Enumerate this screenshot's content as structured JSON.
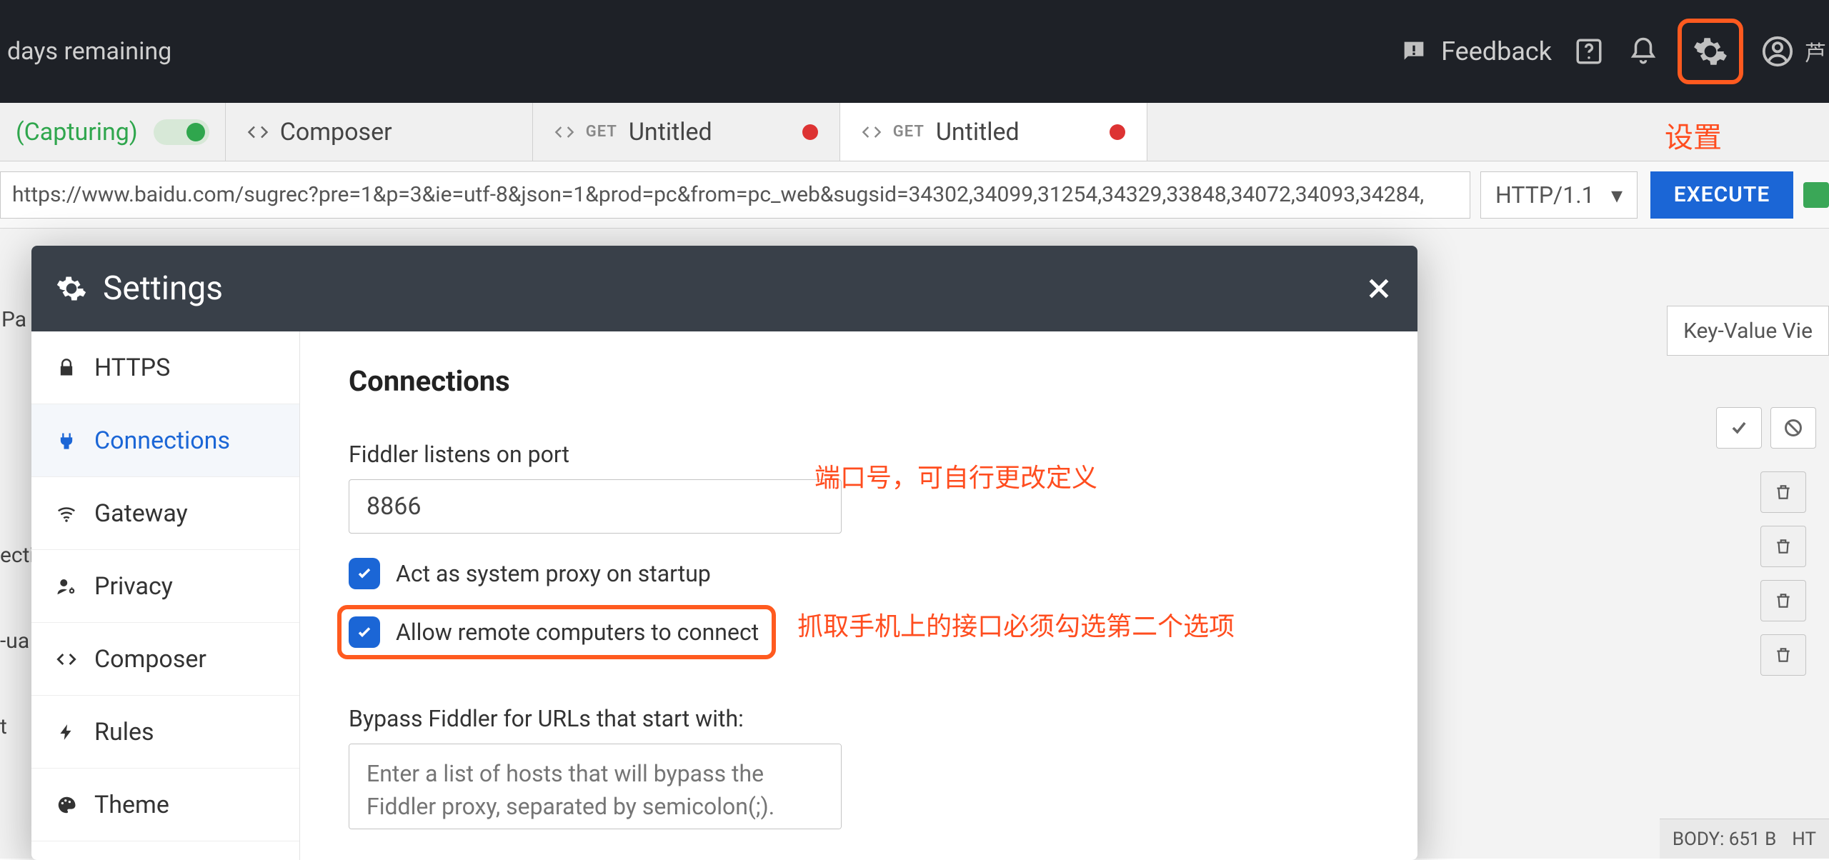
{
  "topbar": {
    "trial_text": "days remaining",
    "feedback_label": "Feedback"
  },
  "annotations": {
    "settings_gear": "设置",
    "port_note": "端口号，可自行更改定义",
    "remote_note": "抓取手机上的接口必须勾选第二个选项"
  },
  "tabs_row": {
    "capturing_label": "(Capturing)",
    "tabs": [
      {
        "method": "",
        "label": "Composer",
        "modified": false
      },
      {
        "method": "GET",
        "label": "Untitled",
        "modified": true
      },
      {
        "method": "GET",
        "label": "Untitled",
        "modified": true
      }
    ]
  },
  "url_row": {
    "url": "https://www.baidu.com/sugrec?pre=1&p=3&ie=utf-8&json=1&prod=pc&from=pc_web&sugsid=34302,34099,31254,34329,33848,34072,34093,34284,",
    "http_version": "HTTP/1.1",
    "execute_label": "EXECUTE"
  },
  "background": {
    "pa_label": "Pa",
    "kv_label": "Key-Value Vie",
    "truncated_rows": [
      "ecti",
      "-ua",
      "t"
    ],
    "status_body": "BODY: 651 B",
    "status_ht": "HT"
  },
  "modal": {
    "title": "Settings",
    "sidebar": [
      {
        "key": "https",
        "label": "HTTPS",
        "icon": "lock"
      },
      {
        "key": "connections",
        "label": "Connections",
        "icon": "plug"
      },
      {
        "key": "gateway",
        "label": "Gateway",
        "icon": "wifi"
      },
      {
        "key": "privacy",
        "label": "Privacy",
        "icon": "user-cog"
      },
      {
        "key": "composer",
        "label": "Composer",
        "icon": "code"
      },
      {
        "key": "rules",
        "label": "Rules",
        "icon": "bolt"
      },
      {
        "key": "theme",
        "label": "Theme",
        "icon": "palette"
      }
    ],
    "content": {
      "heading": "Connections",
      "port_label": "Fiddler listens on port",
      "port_value": "8866",
      "cb_system_proxy": "Act as system proxy on startup",
      "cb_allow_remote": "Allow remote computers to connect",
      "bypass_label": "Bypass Fiddler for URLs that start with:",
      "bypass_placeholder": "Enter a list of hosts that will bypass the Fiddler proxy, separated by semicolon(;)."
    }
  }
}
